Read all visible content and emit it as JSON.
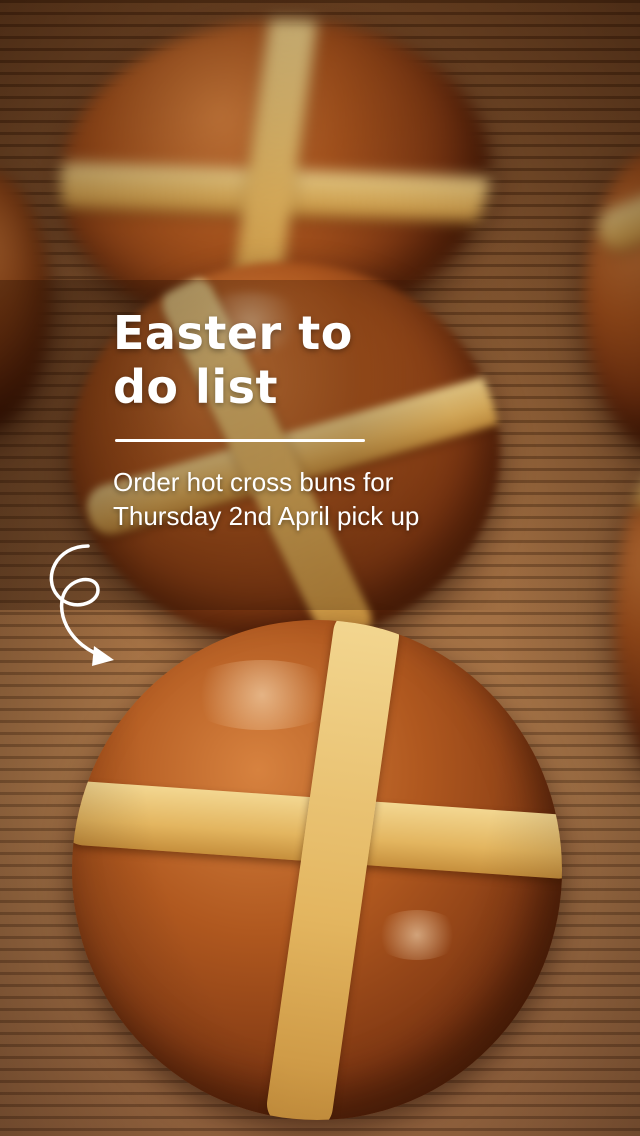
{
  "photo": {
    "subject": "hot-cross-buns-photo",
    "accent_colors": {
      "bun_crust": "#b0581f",
      "cross_paste": "#f3d791",
      "basket": "#a77244",
      "text": "#ffffff"
    }
  },
  "overlay": {
    "title": "Easter to do list",
    "subtitle": "Order hot cross buns for Thursday 2nd April pick up",
    "arrow_icon": "curly-arrow-icon"
  }
}
